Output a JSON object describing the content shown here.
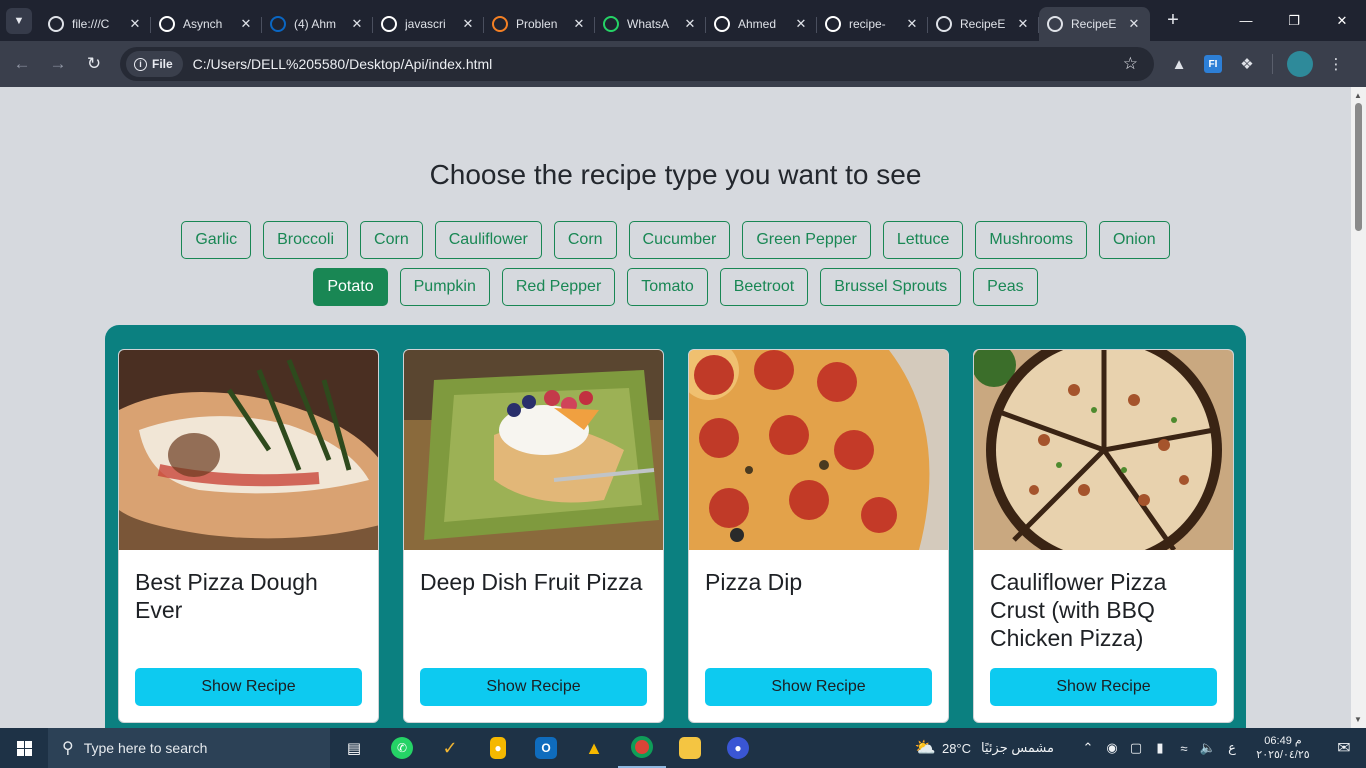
{
  "browser": {
    "tabs": [
      {
        "title": "file:///C",
        "favicon": "globe-icon",
        "color": "#dfe2e8"
      },
      {
        "title": "Asynch",
        "favicon": "openai-icon",
        "color": "#ffffff"
      },
      {
        "title": "(4) Ahm",
        "favicon": "linkedin-icon",
        "color": "#0a66c2"
      },
      {
        "title": "javascri",
        "favicon": "github-icon",
        "color": "#ffffff"
      },
      {
        "title": "Problen",
        "favicon": "stackoverflow-icon",
        "color": "#f48024"
      },
      {
        "title": "WhatsA",
        "favicon": "whatsapp-icon",
        "color": "#25d366"
      },
      {
        "title": "Ahmed",
        "favicon": "github-icon",
        "color": "#ffffff"
      },
      {
        "title": "recipe-",
        "favicon": "vercel-icon",
        "color": "#ffffff"
      },
      {
        "title": "RecipeE",
        "favicon": "globe-icon",
        "color": "#dfe2e8"
      },
      {
        "title": "RecipeE",
        "favicon": "globe-icon",
        "color": "#dfe2e8",
        "active": true
      }
    ],
    "address": {
      "scheme_label": "File",
      "url": "C:/Users/DELL%205580/Desktop/Api/index.html"
    }
  },
  "page": {
    "heading": "Choose the recipe type you want to see",
    "filters": [
      {
        "label": "Garlic"
      },
      {
        "label": "Broccoli"
      },
      {
        "label": "Corn"
      },
      {
        "label": "Cauliflower"
      },
      {
        "label": "Corn"
      },
      {
        "label": "Cucumber"
      },
      {
        "label": "Green Pepper"
      },
      {
        "label": "Lettuce"
      },
      {
        "label": "Mushrooms"
      },
      {
        "label": "Onion"
      },
      {
        "label": "Potato",
        "active": true
      },
      {
        "label": "Pumpkin"
      },
      {
        "label": "Red Pepper"
      },
      {
        "label": "Tomato"
      },
      {
        "label": "Beetroot"
      },
      {
        "label": "Brussel Sprouts"
      },
      {
        "label": "Peas"
      }
    ],
    "colors": {
      "accent": "#198754",
      "panel": "#0b8080",
      "button": "#0dcaf0"
    },
    "cards": [
      {
        "title": "Best Pizza Dough Ever",
        "button": "Show Recipe",
        "image": "pizza-dough-photo"
      },
      {
        "title": "Deep Dish Fruit Pizza",
        "button": "Show Recipe",
        "image": "fruit-pizza-photo"
      },
      {
        "title": "Pizza Dip",
        "button": "Show Recipe",
        "image": "pizza-dip-photo"
      },
      {
        "title": "Cauliflower Pizza Crust (with BBQ Chicken Pizza)",
        "button": "Show Recipe",
        "image": "bbq-chicken-pizza-photo"
      }
    ]
  },
  "taskbar": {
    "search_placeholder": "Type here to search",
    "weather": "28°C",
    "weather_desc": "مشمس جزئيًا",
    "lang": "ع",
    "time": "06:49 م",
    "date": "٢٠٢٥/٠٤/٢٥"
  }
}
